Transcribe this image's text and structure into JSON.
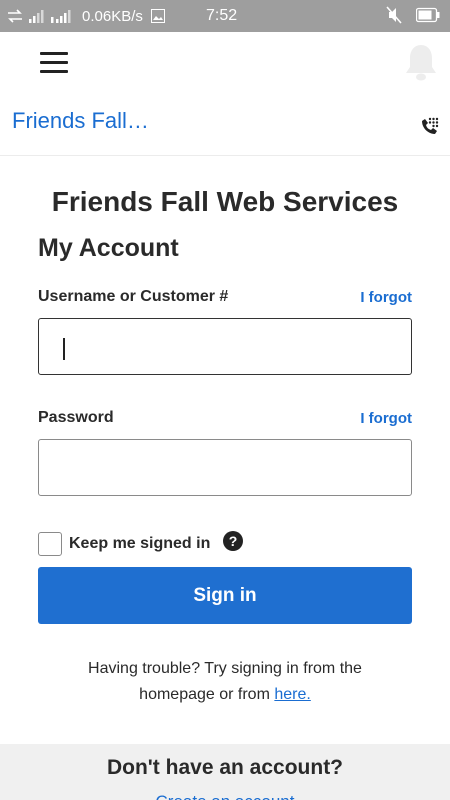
{
  "status_bar": {
    "network": "4G",
    "speed": "0.06KB/s",
    "time": "7:52"
  },
  "header": {
    "brand_link": "Friends Fall…",
    "menu_icon": "hamburger-icon",
    "bell_icon": "bell-icon",
    "phone_icon": "phone-keypad-icon"
  },
  "login": {
    "site_title": "Friends Fall Web Services",
    "section_title": "My Account",
    "username_label": "Username or Customer #",
    "username_forgot": "I forgot",
    "username_value": "",
    "password_label": "Password",
    "password_forgot": "I forgot",
    "password_value": "",
    "keep_signed_in_label": "Keep me signed in",
    "keep_signed_in_checked": false,
    "help_icon": "question-circle-icon",
    "sign_in_button": "Sign in",
    "trouble_text": "Having trouble? Try signing in from the homepage or from",
    "trouble_link": "here."
  },
  "footer": {
    "no_account_title": "Don't have an account?",
    "create_account_link": "Create an account"
  },
  "colors": {
    "accent": "#1f6fd0",
    "link": "#1a6dd1",
    "status_bar": "#9e9e9e",
    "footer_bg": "#f0f0f0"
  }
}
